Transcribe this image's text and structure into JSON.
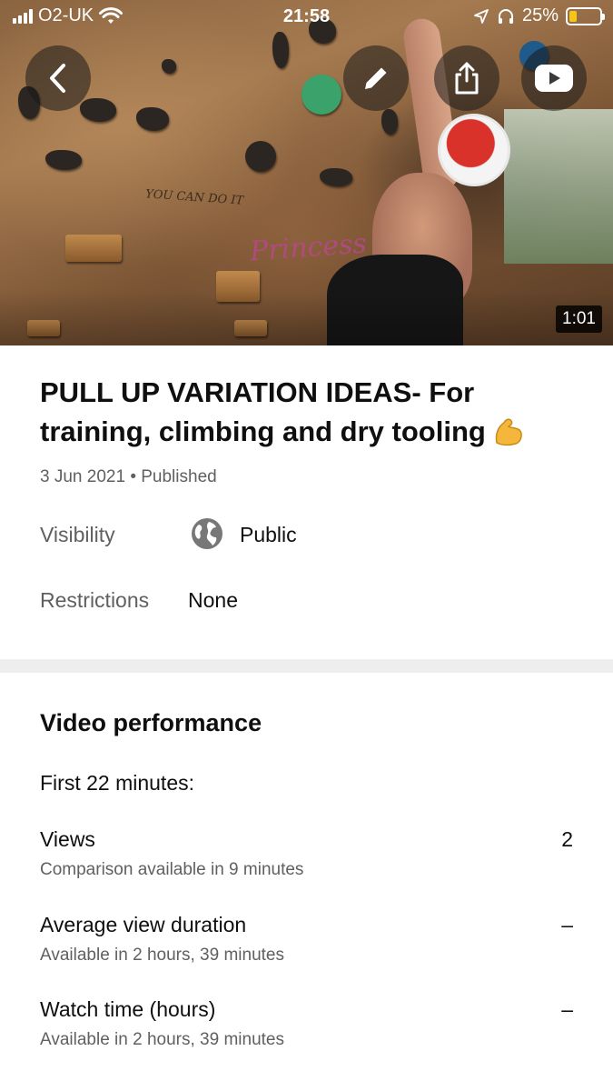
{
  "status_bar": {
    "carrier": "O2-UK",
    "time": "21:58",
    "battery_percent": "25%",
    "battery_level": 0.25,
    "icons": [
      "signal-bars-icon",
      "wifi-icon",
      "location-arrow-icon",
      "headphones-icon",
      "battery-icon"
    ]
  },
  "video": {
    "duration": "1:01",
    "controls": {
      "back": "back-chevron-icon",
      "edit": "pencil-icon",
      "share": "share-icon",
      "open_youtube": "youtube-play-icon"
    },
    "wall_text": {
      "scribble": "YOU CAN DO IT",
      "princess": "Princess"
    }
  },
  "details": {
    "title": "PULL UP VARIATION IDEAS- For training, climbing and dry tooling",
    "title_emoji": "💪",
    "date": "3 Jun 2021",
    "status": "Published",
    "visibility_label": "Visibility",
    "visibility_value": "Public",
    "restrictions_label": "Restrictions",
    "restrictions_value": "None"
  },
  "performance": {
    "section_title": "Video performance",
    "period": "First 22 minutes:",
    "metrics": [
      {
        "label": "Views",
        "sub": "Comparison available in 9 minutes",
        "value": "2"
      },
      {
        "label": "Average view duration",
        "sub": "Available in 2 hours, 39 minutes",
        "value": "–"
      },
      {
        "label": "Watch time (hours)",
        "sub": "Available in 2 hours, 39 minutes",
        "value": "–"
      }
    ]
  },
  "colors": {
    "text_primary": "#0f0f0f",
    "text_secondary": "#606060",
    "divider": "#eeeeee",
    "battery_fill": "#f5c518"
  }
}
